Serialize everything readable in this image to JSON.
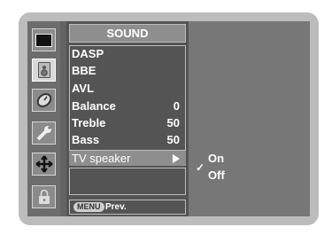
{
  "menu": {
    "title": "SOUND",
    "items": [
      {
        "label": "DASP",
        "value": ""
      },
      {
        "label": "BBE",
        "value": ""
      },
      {
        "label": "AVL",
        "value": ""
      },
      {
        "label": "Balance",
        "value": "0"
      },
      {
        "label": "Treble",
        "value": "50"
      },
      {
        "label": "Bass",
        "value": "50"
      }
    ],
    "selected": {
      "label": "TV speaker",
      "icon": "right-arrow-icon"
    }
  },
  "footer": {
    "button": "MENU",
    "action": "Prev."
  },
  "submenu": {
    "options": [
      {
        "label": "On",
        "checked": true,
        "check_mark": "✓"
      },
      {
        "label": "Off",
        "checked": false
      }
    ]
  },
  "sidebar": {
    "icons": [
      "screen-icon",
      "speaker-icon",
      "clock-icon",
      "tools-icon",
      "cross-arrows-icon",
      "lock-icon"
    ],
    "active": "speaker-icon"
  },
  "colors": {
    "panel": "#636363",
    "highlight": "#8e8e8e",
    "active_icon": "#d9d9d9"
  }
}
